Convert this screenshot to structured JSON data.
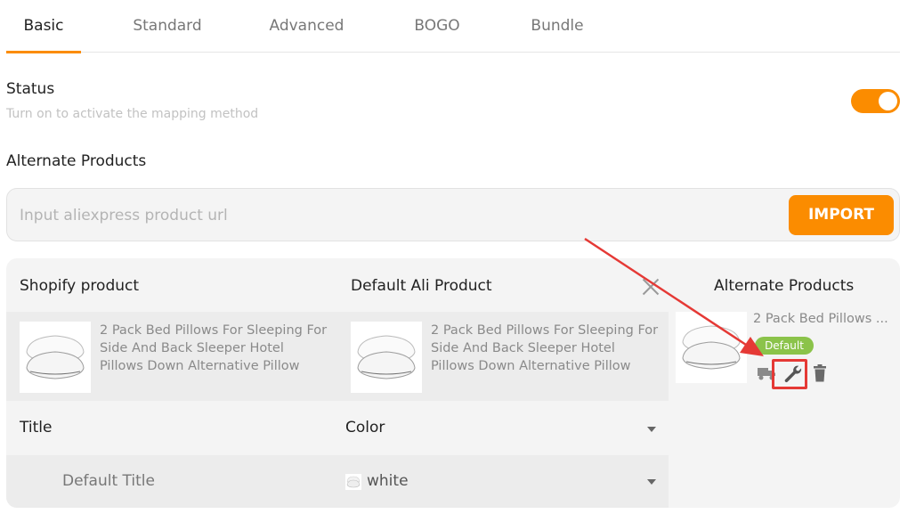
{
  "tabs": [
    {
      "label": "Basic"
    },
    {
      "label": "Standard"
    },
    {
      "label": "Advanced"
    },
    {
      "label": "BOGO"
    },
    {
      "label": "Bundle"
    }
  ],
  "status": {
    "title": "Status",
    "subtitle": "Turn on to activate the mapping method",
    "enabled": true
  },
  "alternate_products": {
    "title": "Alternate Products",
    "url_placeholder": "Input aliexpress product url",
    "url_value": "",
    "import_label": "IMPORT"
  },
  "mapping": {
    "shopify_header": "Shopify product",
    "ali_header": "Default Ali Product",
    "alternate_header": "Alternate Products",
    "shopify_product_name": "2 Pack Bed Pillows For Sleeping For Side And Back Sleeper Hotel Pillows Down Alternative Pillow",
    "ali_product_name": "2 Pack Bed Pillows For Sleeping For Side And Back Sleeper Hotel Pillows Down Alternative Pillow",
    "alternate_product_name": "2 Pack Bed Pillows ...",
    "default_badge": "Default",
    "option_title_label": "Title",
    "option_color_label": "Color",
    "variant_title": "Default Title",
    "variant_color": "white"
  },
  "colors": {
    "accent": "#fb8c00",
    "badge": "#8bc34a",
    "highlight": "#e53935"
  }
}
